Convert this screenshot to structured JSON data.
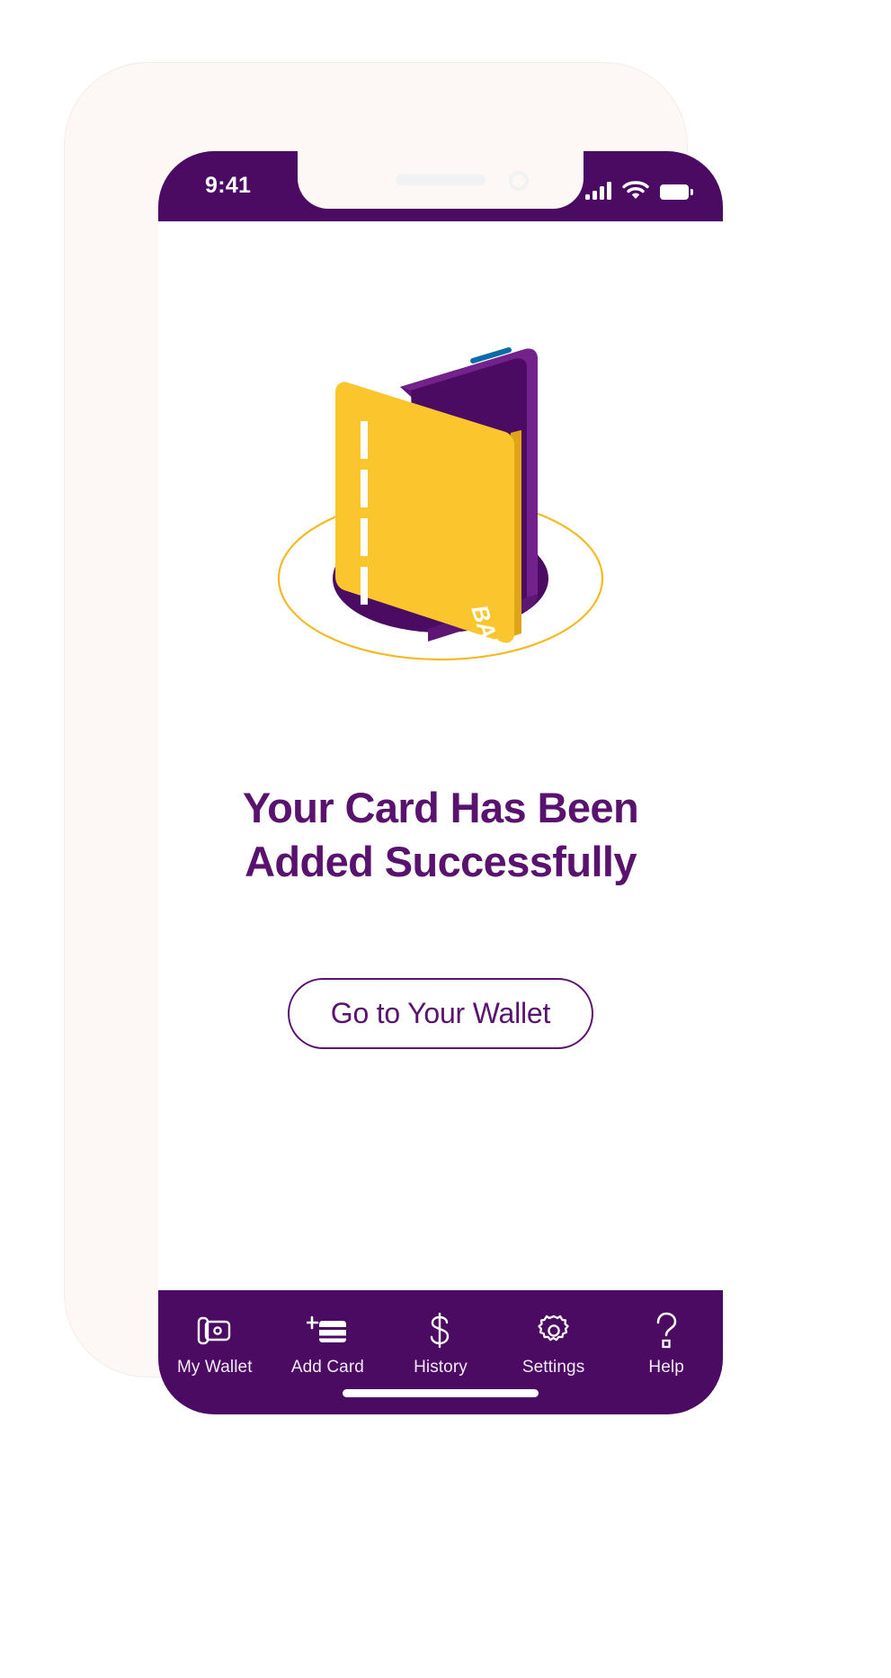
{
  "theme": {
    "purple_dark": "#4B0B63",
    "purple": "#59136E",
    "purple_mid": "#6B2080",
    "yellow": "#FBC52D",
    "yellow_outline": "#F5B921",
    "blue_accent": "#0E6BA8",
    "frame": "#FDF8F5",
    "screen_bg": "#FFFFFF",
    "nav_label": "#F3EAF6"
  },
  "statusbar": {
    "time": "9:41",
    "signal_icon": "cellular-signal-icon",
    "wifi_icon": "wifi-icon",
    "battery_icon": "battery-icon"
  },
  "illustration": {
    "name": "card-added-illustration",
    "card_label": "BANK",
    "wallet_icon": "wallet-phone-shape",
    "base_ellipse": "purple-ellipse-shadow",
    "outline_ellipse": "yellow-ellipse-outline"
  },
  "main": {
    "headline_line1": "Your Card Has Been",
    "headline_line2": "Added Successfully",
    "cta_label": "Go to Your Wallet"
  },
  "bottom_nav": {
    "items": [
      {
        "label": "My Wallet",
        "icon": "wallet-icon"
      },
      {
        "label": "Add Card",
        "icon": "add-card-icon"
      },
      {
        "label": "History",
        "icon": "dollar-icon"
      },
      {
        "label": "Settings",
        "icon": "gear-icon"
      },
      {
        "label": "Help",
        "icon": "question-mark-icon"
      }
    ]
  },
  "home_indicator": "home-indicator-bar"
}
